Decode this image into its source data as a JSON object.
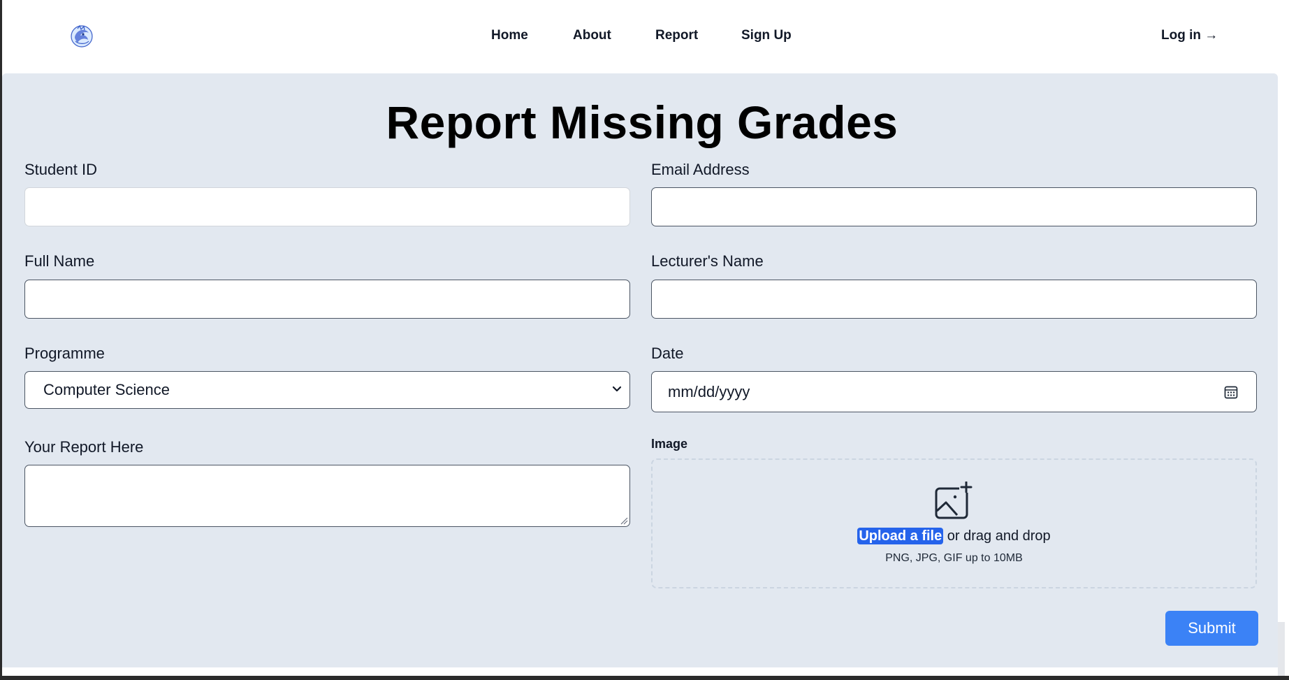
{
  "header": {
    "logo_icon": "dragon-logo-icon",
    "nav": [
      "Home",
      "About",
      "Report",
      "Sign Up"
    ],
    "login": "Log in →"
  },
  "page": {
    "title": "Report Missing Grades"
  },
  "form": {
    "student_id": {
      "label": "Student ID",
      "value": ""
    },
    "email": {
      "label": "Email Address",
      "value": ""
    },
    "full_name": {
      "label": "Full Name",
      "value": ""
    },
    "lecturer": {
      "label": "Lecturer's Name",
      "value": ""
    },
    "programme": {
      "label": "Programme",
      "selected": "Computer Science"
    },
    "date": {
      "label": "Date",
      "placeholder": "mm/dd/yyyy"
    },
    "report": {
      "label": "Your Report Here",
      "value": ""
    },
    "image": {
      "label": "Image",
      "upload_link": "Upload a file",
      "upload_text": " or drag and drop",
      "hint": "PNG, JPG, GIF up to 10MB"
    },
    "submit": "Submit"
  },
  "colors": {
    "accent": "#3b82f6",
    "upload_highlight": "#2563eb",
    "panel_bg": "#e2e8f0"
  }
}
